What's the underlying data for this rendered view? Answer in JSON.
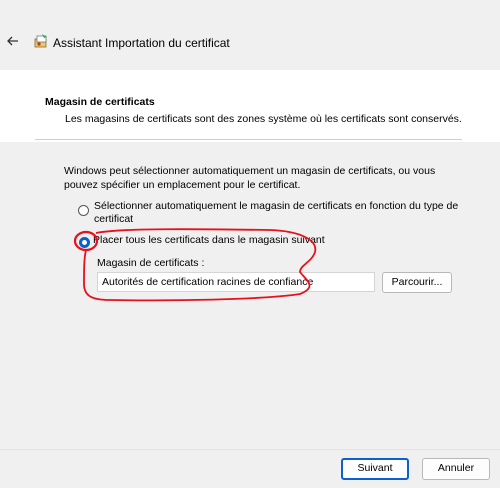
{
  "window": {
    "title": "Assistant Importation du certificat",
    "back_icon": "back-arrow-icon",
    "title_icon": "certificate-wizard-icon"
  },
  "section": {
    "title": "Magasin de certificats",
    "description": "Les magasins de certificats sont des zones système où les certificats sont conservés."
  },
  "main": {
    "intro": "Windows peut sélectionner automatiquement un magasin de certificats, ou vous pouvez spécifier un emplacement pour le certificat.",
    "options": [
      {
        "label": "Sélectionner automatiquement le magasin de certificats en fonction du type de certificat",
        "selected": false
      },
      {
        "label": "Placer tous les certificats dans le magasin suivant",
        "selected": true
      }
    ],
    "store_label": "Magasin de certificats :",
    "store_value": "Autorités de certification racines de confiance",
    "browse_label": "Parcourir..."
  },
  "footer": {
    "next_label": "Suivant",
    "cancel_label": "Annuler"
  },
  "colors": {
    "accent": "#0a5fd1",
    "annotation": "#e8101c",
    "background": "#f0f0f0"
  }
}
